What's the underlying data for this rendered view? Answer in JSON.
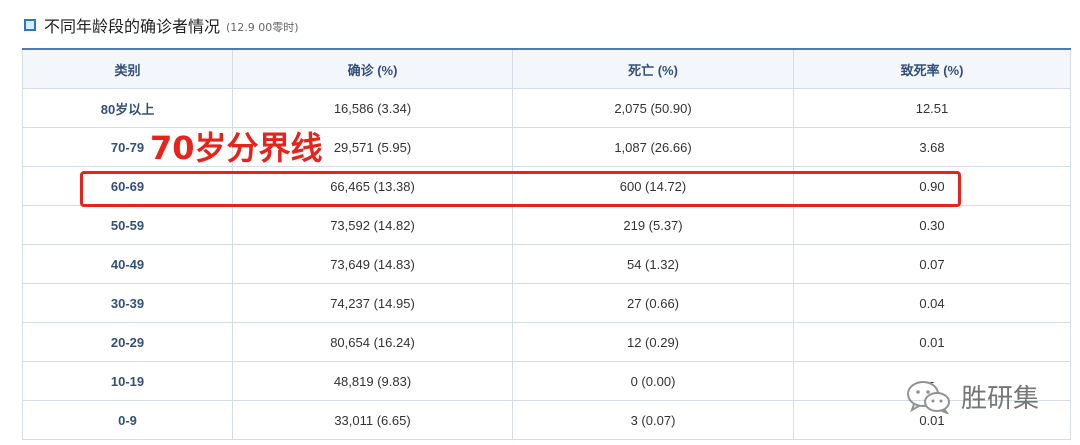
{
  "header": {
    "title": "不同年龄段的确诊者情况",
    "subtitle": "(12.9 00零时)"
  },
  "table": {
    "columns": [
      "类别",
      "确诊 (%)",
      "死亡 (%)",
      "致死率 (%)"
    ],
    "rows": [
      {
        "category": "80岁以上",
        "confirmed": "16,586 (3.34)",
        "deaths": "2,075 (50.90)",
        "fatality": "12.51"
      },
      {
        "category": "70-79",
        "confirmed": "29,571 (5.95)",
        "deaths": "1,087 (26.66)",
        "fatality": "3.68"
      },
      {
        "category": "60-69",
        "confirmed": "66,465 (13.38)",
        "deaths": "600 (14.72)",
        "fatality": "0.90"
      },
      {
        "category": "50-59",
        "confirmed": "73,592 (14.82)",
        "deaths": "219 (5.37)",
        "fatality": "0.30"
      },
      {
        "category": "40-49",
        "confirmed": "73,649 (14.83)",
        "deaths": "54 (1.32)",
        "fatality": "0.07"
      },
      {
        "category": "30-39",
        "confirmed": "74,237 (14.95)",
        "deaths": "27 (0.66)",
        "fatality": "0.04"
      },
      {
        "category": "20-29",
        "confirmed": "80,654 (16.24)",
        "deaths": "12 (0.29)",
        "fatality": "0.01"
      },
      {
        "category": "10-19",
        "confirmed": "48,819 (9.83)",
        "deaths": "0 (0.00)",
        "fatality": "-"
      },
      {
        "category": "0-9",
        "confirmed": "33,011 (6.65)",
        "deaths": "3 (0.07)",
        "fatality": "0.01"
      }
    ]
  },
  "annotation": {
    "text": "70岁分界线",
    "color": "#e8231b"
  },
  "watermark": {
    "icon": "wechat-icon",
    "text": "胜研集"
  }
}
